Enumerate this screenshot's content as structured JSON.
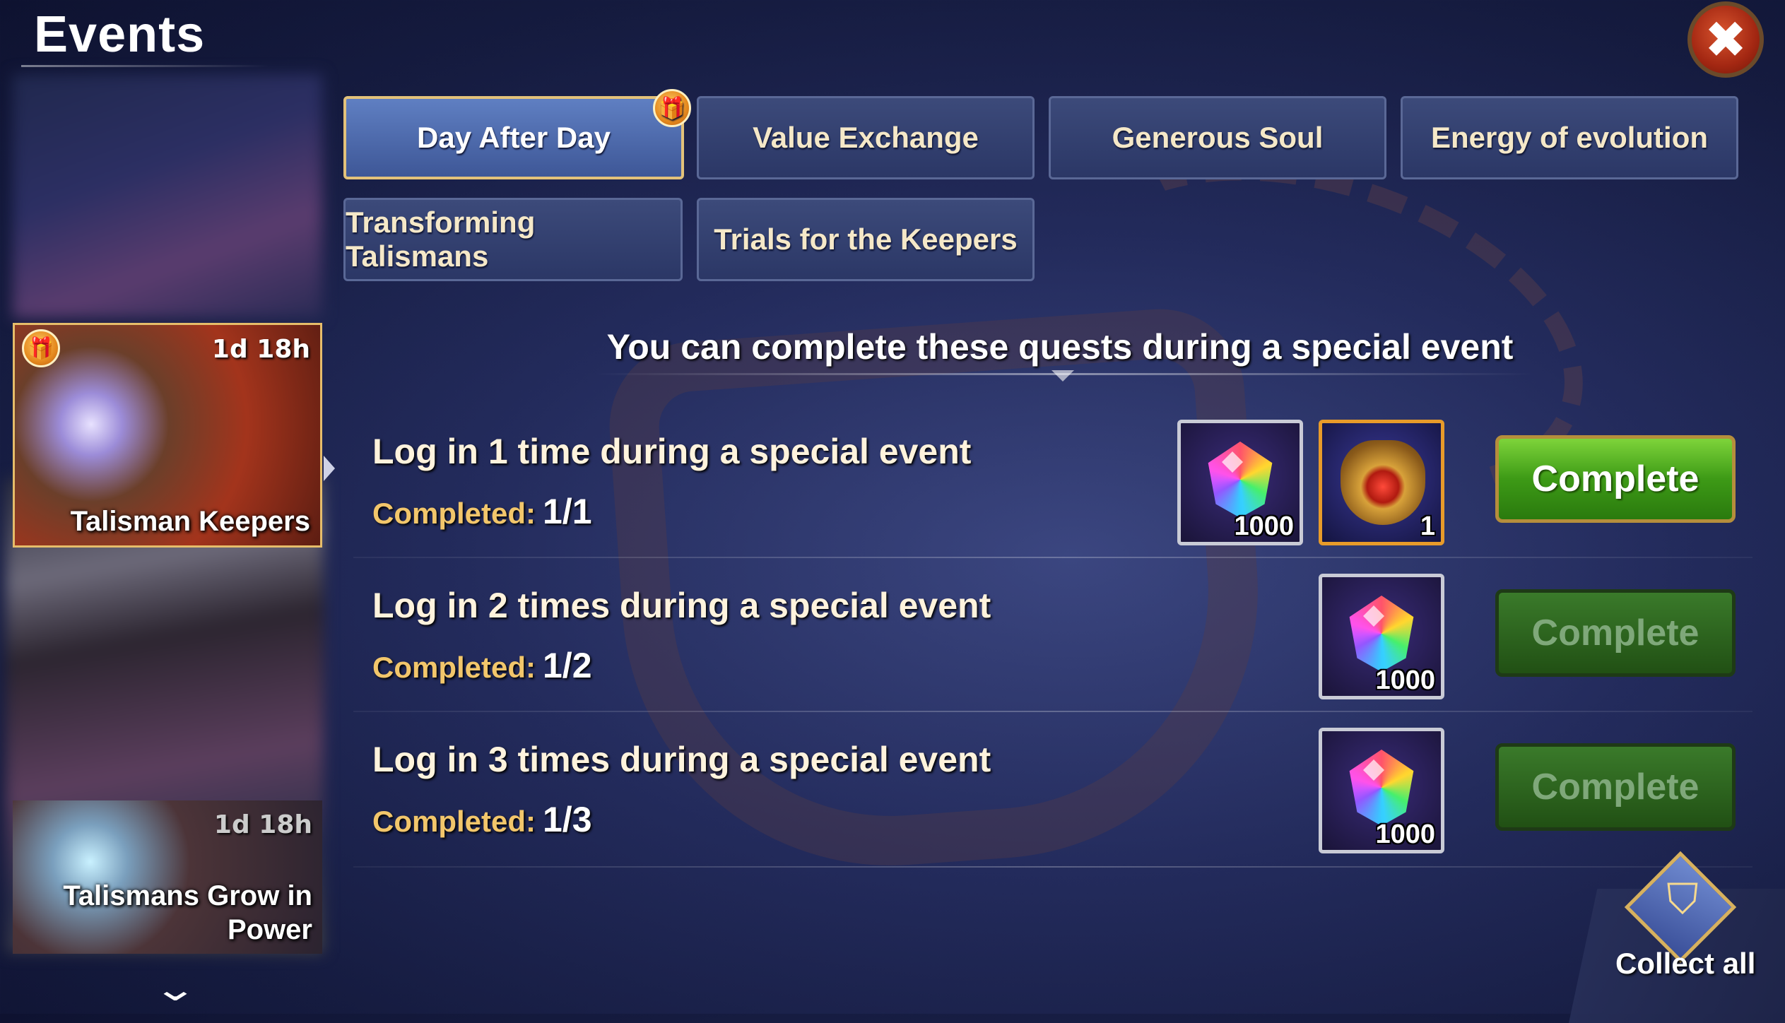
{
  "header": {
    "title": "Events",
    "close_icon": "✖"
  },
  "sidebar": {
    "cards": [
      {
        "name": "",
        "timer": "",
        "blurred": true
      },
      {
        "name": "Talisman Keepers",
        "timer": "1d 18h",
        "active": true,
        "has_gift": true
      },
      {
        "name": "",
        "timer": "",
        "blurred": true
      },
      {
        "name": "Talismans Grow in Power",
        "timer": "1d 18h"
      }
    ]
  },
  "tabs": [
    {
      "label": "Day After Day",
      "active": true,
      "has_gift": true
    },
    {
      "label": "Value Exchange"
    },
    {
      "label": "Generous Soul"
    },
    {
      "label": "Energy of evolution"
    },
    {
      "label": "Transforming Talismans"
    },
    {
      "label": "Trials for the Keepers"
    }
  ],
  "info": "You can complete these quests during a special event",
  "quests": [
    {
      "title": "Log in 1 time during a special event",
      "progress_label": "Completed:",
      "progress": "1/1",
      "rewards": [
        {
          "icon": "gem-icon",
          "qty": "1000"
        },
        {
          "icon": "talisman-icon",
          "qty": "1"
        }
      ],
      "button": "Complete",
      "button_enabled": true
    },
    {
      "title": "Log in 2 times during a special event",
      "progress_label": "Completed:",
      "progress": "1/2",
      "rewards": [
        {
          "icon": "gem-icon",
          "qty": "1000"
        }
      ],
      "button": "Complete",
      "button_enabled": false
    },
    {
      "title": "Log in 3 times during a special event",
      "progress_label": "Completed:",
      "progress": "1/3",
      "rewards": [
        {
          "icon": "gem-icon",
          "qty": "1000"
        }
      ],
      "button": "Complete",
      "button_enabled": false
    }
  ],
  "collect_all": {
    "label": "Collect all"
  },
  "colors": {
    "accent_gold": "#e3c27a",
    "complete_green": "#3d9a16",
    "progress_gold": "#f2c66b"
  }
}
